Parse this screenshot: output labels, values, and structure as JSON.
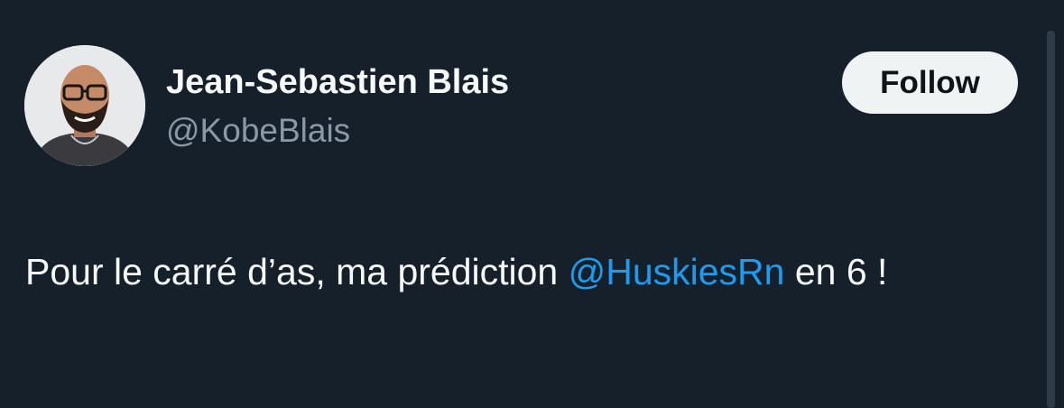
{
  "author": {
    "display_name": "Jean-Sebastien Blais",
    "handle": "@KobeBlais"
  },
  "follow_button": {
    "label": "Follow"
  },
  "tweet": {
    "text_before": "Pour le carré d’as, ma prédiction ",
    "mention": "@HuskiesRn",
    "text_after": " en 6 !"
  },
  "colors": {
    "background": "#15202b",
    "text_primary": "#f7f9f9",
    "text_secondary": "#8b98a5",
    "link": "#1d9bf0",
    "button_bg": "#eff3f4"
  }
}
